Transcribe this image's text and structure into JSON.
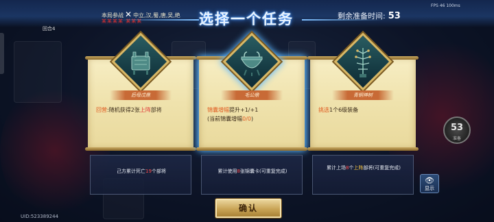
{
  "top": {
    "faction_text": "本局参战",
    "faction_list": "中立,汉,蜀,唐,吴,绝",
    "faction_sub": "某某某某 某某某",
    "title": "选择一个任务",
    "timer_label": "剩余准备时间:",
    "timer_value": "53",
    "fps": "FPS 46   100ms",
    "round": "回合4"
  },
  "cards": [
    {
      "name": "后母戊鼎",
      "icon": "ding-cauldron-icon",
      "desc_prefix": "回营",
      "desc_mid": ":随机获得2张",
      "desc_hl": "上阵",
      "desc_suffix": "部将",
      "task_pre": "己方累计死亡",
      "task_num": "19",
      "task_post": "个部将"
    },
    {
      "name": "毛公鼎",
      "icon": "round-ding-icon",
      "line1_hl": "锦囊增幅",
      "line1_rest": "提升+1/+1",
      "line2_pre": "(当前锦囊增幅",
      "line2_hl": "0/0",
      "line2_post": ")",
      "task_pre": "累计使用",
      "task_num": "8",
      "task_post": "张锦囊卡(可重复完成)"
    },
    {
      "name": "青铜神树",
      "icon": "bronze-tree-icon",
      "desc_hl": "挑选",
      "desc_rest": "1个6级装备",
      "task_pre": "累计上场",
      "task_num": "8",
      "task_mid": "个",
      "task_hl": "上阵",
      "task_post": "部将(可重复完成)"
    }
  ],
  "side": {
    "badge_num": "53",
    "badge_label": "准备",
    "show_label": "显示"
  },
  "confirm_label": "确认",
  "uid": "UID:523389244"
}
